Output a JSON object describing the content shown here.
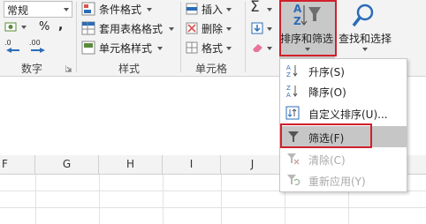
{
  "ribbon": {
    "number_format_value": "常规",
    "percent_symbol": "%",
    "comma_symbol": ",",
    "currency_symbol": "$",
    "increase_decimal": ".0",
    "decrease_decimal": ".00",
    "group_number": "数字",
    "conditional_format": "条件格式",
    "table_format": "套用表格格式",
    "cell_style": "单元格样式",
    "group_style": "样式",
    "insert": "插入",
    "delete": "删除",
    "format": "格式",
    "group_cells": "单元格",
    "sort_filter": "排序和筛选",
    "find_select": "查找和选择"
  },
  "columns": [
    "F",
    "G",
    "H",
    "I",
    "J"
  ],
  "sort_menu": {
    "items": [
      {
        "label": "升序(S)",
        "enabled": true
      },
      {
        "label": "降序(O)",
        "enabled": true
      },
      {
        "label": "自定义排序(U)...",
        "enabled": true
      },
      {
        "label": "筛选(F)",
        "enabled": true,
        "highlighted": true
      },
      {
        "label": "清除(C)",
        "enabled": false
      },
      {
        "label": "重新应用(Y)",
        "enabled": false
      }
    ]
  },
  "colors": {
    "highlight_box": "#d1202a",
    "accent_blue": "#2b6cb8",
    "ribbon_bg": "#f3f3f3"
  }
}
